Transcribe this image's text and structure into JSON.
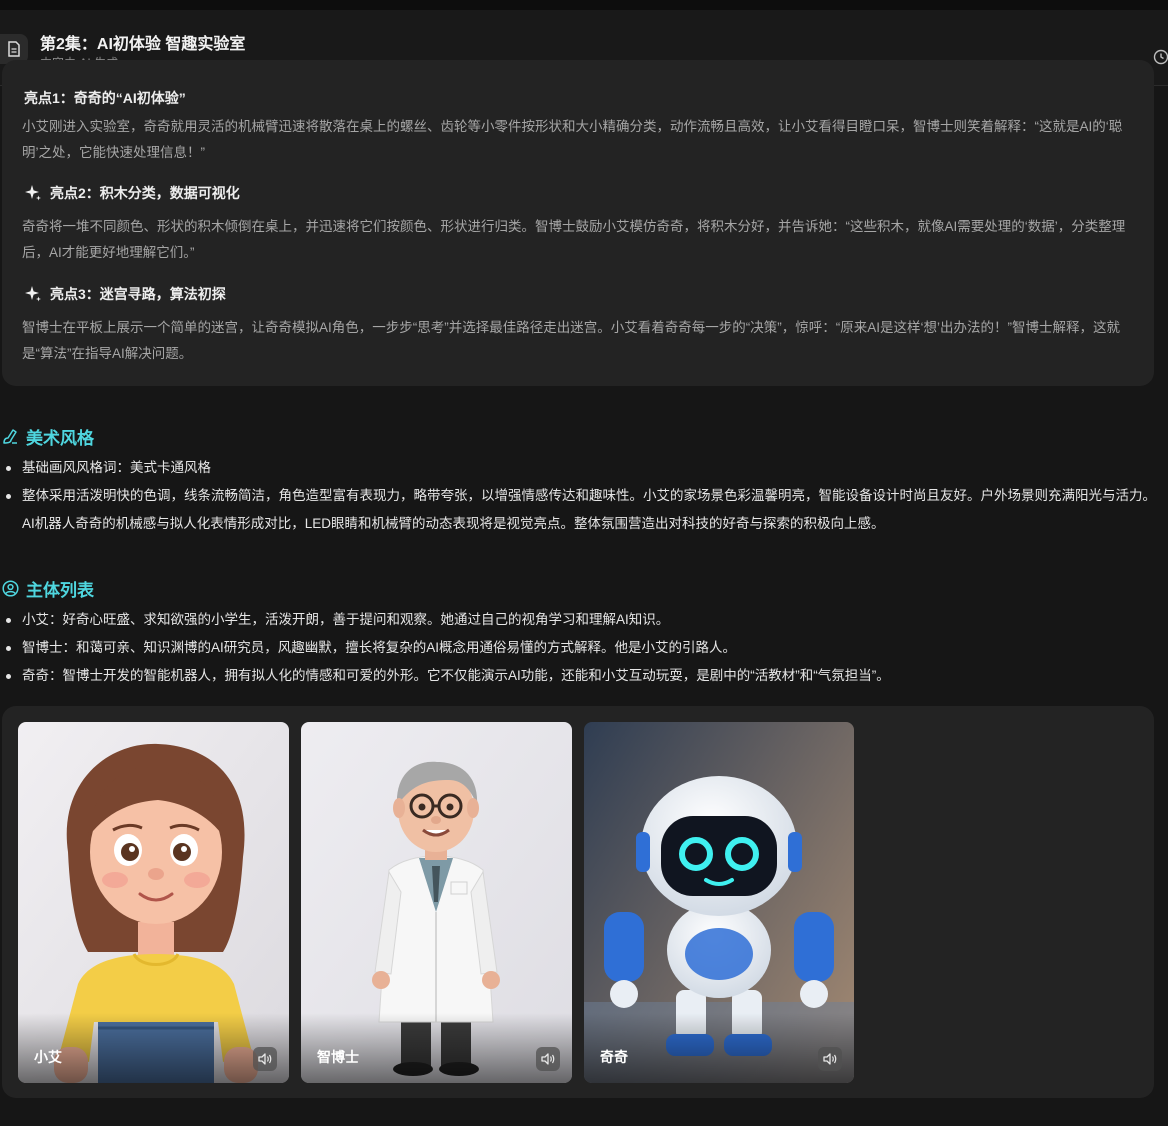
{
  "header": {
    "title": "第2集：AI初体验 智趣实验室",
    "subtitle": "内容由 AI 生成"
  },
  "highlights": {
    "cut_title": "亮点1：奇奇的“AI初体验”",
    "items": [
      {
        "desc": "小艾刚进入实验室，奇奇就用灵活的机械臂迅速将散落在桌上的螺丝、齿轮等小零件按形状和大小精确分类，动作流畅且高效，让小艾看得目瞪口呆，智博士则笑着解释：“这就是AI的‘聪明’之处，它能快速处理信息！”"
      },
      {
        "title": "亮点2：积木分类，数据可视化",
        "desc": "奇奇将一堆不同颜色、形状的积木倾倒在桌上，并迅速将它们按颜色、形状进行归类。智博士鼓励小艾模仿奇奇，将积木分好，并告诉她：“这些积木，就像AI需要处理的‘数据’，分类整理后，AI才能更好地理解它们。”"
      },
      {
        "title": "亮点3：迷宫寻路，算法初探",
        "desc": "智博士在平板上展示一个简单的迷宫，让奇奇模拟AI角色，一步步“思考”并选择最佳路径走出迷宫。小艾看着奇奇每一步的“决策”，惊呼：“原来AI是这样‘想’出办法的！”智博士解释，这就是“算法”在指导AI解决问题。"
      }
    ]
  },
  "art_style": {
    "title": "美术风格",
    "items": [
      "基础画风风格词：美式卡通风格",
      "整体采用活泼明快的色调，线条流畅简洁，角色造型富有表现力，略带夸张，以增强情感传达和趣味性。小艾的家场景色彩温馨明亮，智能设备设计时尚且友好。户外场景则充满阳光与活力。AI机器人奇奇的机械感与拟人化表情形成对比，LED眼睛和机械臂的动态表现将是视觉亮点。整体氛围营造出对科技的好奇与探索的积极向上感。"
    ]
  },
  "subjects": {
    "title": "主体列表",
    "items": [
      "小艾：好奇心旺盛、求知欲强的小学生，活泼开朗，善于提问和观察。她通过自己的视角学习和理解AI知识。",
      "智博士：和蔼可亲、知识渊博的AI研究员，风趣幽默，擅长将复杂的AI概念用通俗易懂的方式解释。他是小艾的引路人。",
      "奇奇：智博士开发的智能机器人，拥有拟人化的情感和可爱的外形。它不仅能演示AI功能，还能和小艾互动玩耍，是剧中的“活教材”和“气氛担当”。"
    ]
  },
  "characters": [
    {
      "name": "小艾",
      "icon": "speaker-icon"
    },
    {
      "name": "智博士",
      "icon": "speaker-icon"
    },
    {
      "name": "奇奇",
      "icon": "speaker-icon"
    }
  ],
  "colors": {
    "accent": "#4fd6df",
    "background": "#161616",
    "card": "#232323"
  }
}
